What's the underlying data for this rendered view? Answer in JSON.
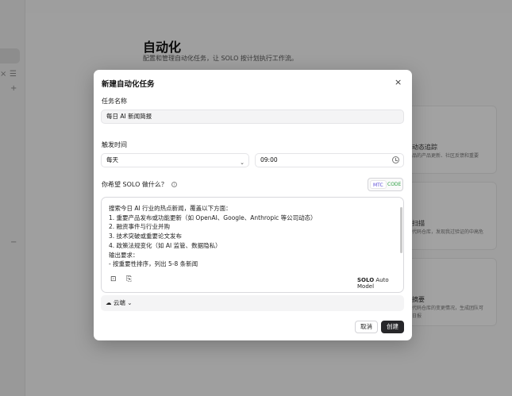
{
  "background": {
    "sidebar": {
      "icons": [
        "sidebar-toggle-icon",
        "list-icon",
        "plus-icon",
        "minus-icon"
      ],
      "glyphs": {
        "toggle": "×",
        "list": "☰",
        "plus": "+",
        "minus": "−"
      }
    },
    "page": {
      "title": "自动化",
      "subtitle": "配置和管理自动化任务，让 SOLO 按计划执行工作流。",
      "cards": [
        {
          "title": "动态追踪",
          "desc": [
            "品的产品更新、社区反馈和重要"
          ]
        },
        {
          "title": "扫描",
          "desc": [
            "代码仓库，发现我过验证的中高危"
          ]
        },
        {
          "title": "摘要",
          "desc": [
            "代码仓库的变更情况，生成团队可",
            "日报"
          ]
        }
      ]
    }
  },
  "modal": {
    "title": "新建自动化任务",
    "close_glyph": "×",
    "task_name": {
      "label": "任务名称",
      "value": "每日 AI 新闻简报"
    },
    "trigger": {
      "label": "触发时间",
      "frequency": "每天",
      "time": "09:00",
      "caret": "⌄"
    },
    "want": {
      "label": "你希望 SOLO 做什么？",
      "info_glyph": "i"
    },
    "mode_toggle": {
      "mtc": "MTC",
      "code": "CODE",
      "selected": "MTC"
    },
    "prompt_lines": [
      "搜索今日 AI 行业的热点新闻，覆盖以下方面：",
      "1. 重要产品发布或功能更新（如 OpenAI、Google、Anthropic 等公司动态）",
      "2. 融资事件与行业并购",
      "3. 技术突破或重要论文发布",
      "4. 政策法规变化（如 AI 监管、数据隐私）",
      "输出要求：",
      "- 按重要性排序，列出 5-8 条新闻"
    ],
    "editor_icons": {
      "edit": "⊡",
      "attach": "⎘"
    },
    "model": {
      "brand": "SOLO",
      "name": "Auto Model"
    },
    "environment": {
      "icon": "☁",
      "label": "云端",
      "caret": "⌄"
    },
    "buttons": {
      "cancel": "取消",
      "create": "创建"
    }
  }
}
